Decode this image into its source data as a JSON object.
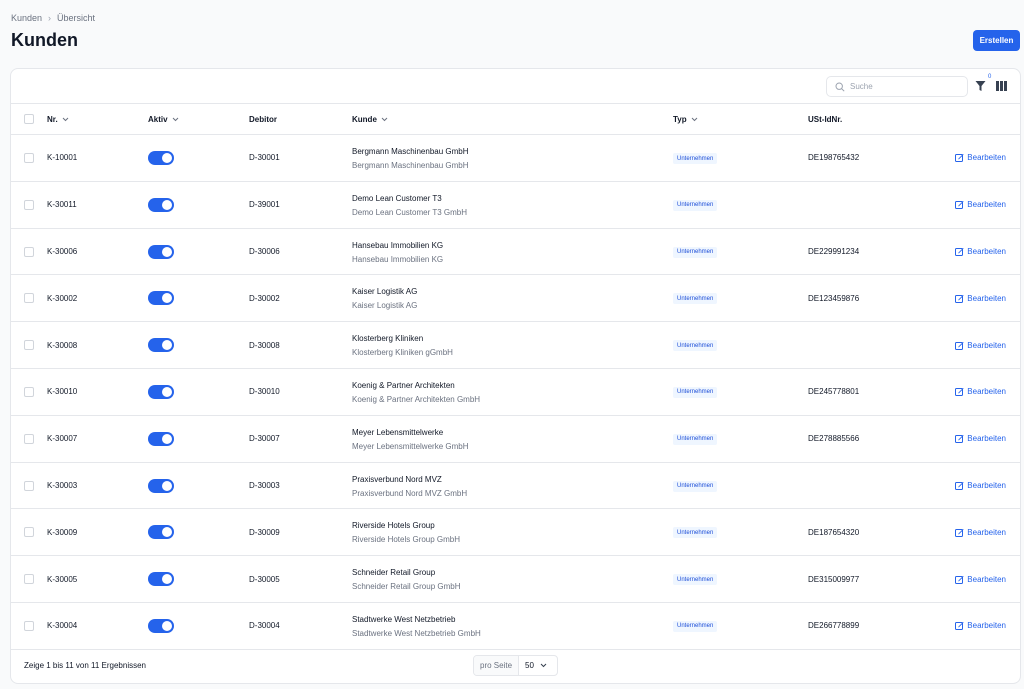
{
  "breadcrumb": {
    "root": "Kunden",
    "current": "Übersicht"
  },
  "page": {
    "title": "Kunden",
    "create_label": "Erstellen"
  },
  "toolbar": {
    "search_placeholder": "Suche",
    "filter_count": "0"
  },
  "columns": {
    "nr": "Nr.",
    "aktiv": "Aktiv",
    "debitor": "Debitor",
    "kunde": "Kunde",
    "typ": "Typ",
    "ustid": "USt-IdNr."
  },
  "rows": [
    {
      "nr": "K-10001",
      "debitor": "D-30001",
      "name": "Bergmann Maschinenbau GmbH",
      "sub": "Bergmann Maschinenbau GmbH",
      "typ": "Unternehmen",
      "ustid": "DE198765432",
      "edit": "Bearbeiten",
      "active": true
    },
    {
      "nr": "K-30011",
      "debitor": "D-39001",
      "name": "Demo Lean Customer T3",
      "sub": "Demo Lean Customer T3 GmbH",
      "typ": "Unternehmen",
      "ustid": "",
      "edit": "Bearbeiten",
      "active": true
    },
    {
      "nr": "K-30006",
      "debitor": "D-30006",
      "name": "Hansebau Immobilien KG",
      "sub": "Hansebau Immobilien KG",
      "typ": "Unternehmen",
      "ustid": "DE229991234",
      "edit": "Bearbeiten",
      "active": true
    },
    {
      "nr": "K-30002",
      "debitor": "D-30002",
      "name": "Kaiser Logistik AG",
      "sub": "Kaiser Logistik AG",
      "typ": "Unternehmen",
      "ustid": "DE123459876",
      "edit": "Bearbeiten",
      "active": true
    },
    {
      "nr": "K-30008",
      "debitor": "D-30008",
      "name": "Klosterberg Kliniken",
      "sub": "Klosterberg Kliniken gGmbH",
      "typ": "Unternehmen",
      "ustid": "",
      "edit": "Bearbeiten",
      "active": true
    },
    {
      "nr": "K-30010",
      "debitor": "D-30010",
      "name": "Koenig & Partner Architekten",
      "sub": "Koenig & Partner Architekten GmbH",
      "typ": "Unternehmen",
      "ustid": "DE245778801",
      "edit": "Bearbeiten",
      "active": true
    },
    {
      "nr": "K-30007",
      "debitor": "D-30007",
      "name": "Meyer Lebensmittelwerke",
      "sub": "Meyer Lebensmittelwerke GmbH",
      "typ": "Unternehmen",
      "ustid": "DE278885566",
      "edit": "Bearbeiten",
      "active": true
    },
    {
      "nr": "K-30003",
      "debitor": "D-30003",
      "name": "Praxisverbund Nord MVZ",
      "sub": "Praxisverbund Nord MVZ GmbH",
      "typ": "Unternehmen",
      "ustid": "",
      "edit": "Bearbeiten",
      "active": true
    },
    {
      "nr": "K-30009",
      "debitor": "D-30009",
      "name": "Riverside Hotels Group",
      "sub": "Riverside Hotels Group GmbH",
      "typ": "Unternehmen",
      "ustid": "DE187654320",
      "edit": "Bearbeiten",
      "active": true
    },
    {
      "nr": "K-30005",
      "debitor": "D-30005",
      "name": "Schneider Retail Group",
      "sub": "Schneider Retail Group GmbH",
      "typ": "Unternehmen",
      "ustid": "DE315009977",
      "edit": "Bearbeiten",
      "active": true
    },
    {
      "nr": "K-30004",
      "debitor": "D-30004",
      "name": "Stadtwerke West Netzbetrieb",
      "sub": "Stadtwerke West Netzbetrieb GmbH",
      "typ": "Unternehmen",
      "ustid": "DE266778899",
      "edit": "Bearbeiten",
      "active": true
    }
  ],
  "footer": {
    "summary": "Zeige 1 bis 11 von 11 Ergebnissen",
    "per_page_label": "pro Seite",
    "per_page_value": "50"
  },
  "colors": {
    "accent": "#2563eb",
    "badge_bg": "#eff6ff",
    "badge_text": "#1d4ed8"
  }
}
